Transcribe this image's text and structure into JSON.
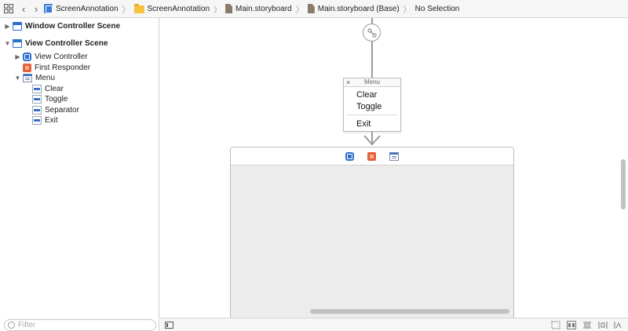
{
  "jumpbar": {
    "crumbs": [
      {
        "label": "ScreenAnnotation",
        "icon": "project-icon"
      },
      {
        "label": "ScreenAnnotation",
        "icon": "folder-icon"
      },
      {
        "label": "Main.storyboard",
        "icon": "storyboard-file-icon"
      },
      {
        "label": "Main.storyboard (Base)",
        "icon": "storyboard-file-icon"
      },
      {
        "label": "No Selection",
        "icon": ""
      }
    ]
  },
  "outline": {
    "window_scene": "Window Controller Scene",
    "vc_scene": "View Controller Scene",
    "view_controller": "View Controller",
    "first_responder": "First Responder",
    "menu": "Menu",
    "menu_items": [
      "Clear",
      "Toggle",
      "Separator",
      "Exit"
    ]
  },
  "filter": {
    "placeholder": "Filter"
  },
  "canvas": {
    "menu_title": "Menu",
    "menu_close": "×",
    "menu_items": [
      "Clear",
      "Toggle",
      "Exit"
    ]
  },
  "colors": {
    "accent": "#2e6fd0",
    "responder": "#e8603a",
    "canvas_view": "#ececec"
  }
}
